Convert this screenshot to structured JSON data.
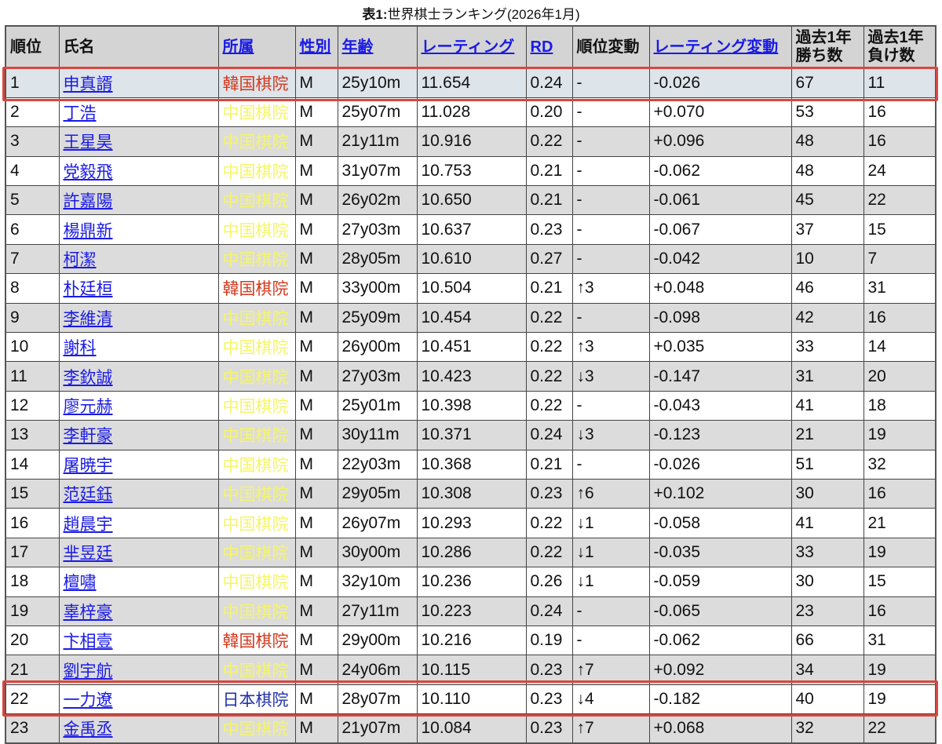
{
  "caption": {
    "prefix": "表1:",
    "text": "世界棋士ランキング(2026年1月)"
  },
  "headers": [
    {
      "label": "順位",
      "link": false
    },
    {
      "label": "氏名",
      "link": false
    },
    {
      "label": "所属",
      "link": true
    },
    {
      "label": "性別",
      "link": true
    },
    {
      "label": "年齢",
      "link": true
    },
    {
      "label": "レーティング",
      "link": true
    },
    {
      "label": "RD",
      "link": true
    },
    {
      "label": "順位変動",
      "link": false
    },
    {
      "label": "レーティング変動",
      "link": true
    },
    {
      "label": "過去1年勝ち数",
      "link": false
    },
    {
      "label": "過去1年負け数",
      "link": false
    }
  ],
  "affiliations": {
    "cn": "中国棋院",
    "kr": "韓国棋院",
    "jp": "日本棋院"
  },
  "colors": {
    "highlight_box": "#d9473f",
    "link": "#1a1ae6",
    "kr": "#d33a1f",
    "cn": "#f5f56a",
    "jp": "#2233aa"
  },
  "rows": [
    {
      "rank": "1",
      "name": "申真諝",
      "aff": "kr",
      "sex": "M",
      "age": "25y10m",
      "rating": "11.654",
      "rd": "0.24",
      "rank_change": "-",
      "rating_change": "-0.026",
      "wins": "67",
      "losses": "11"
    },
    {
      "rank": "2",
      "name": "丁浩",
      "aff": "cn",
      "sex": "M",
      "age": "25y07m",
      "rating": "11.028",
      "rd": "0.20",
      "rank_change": "-",
      "rating_change": "+0.070",
      "wins": "53",
      "losses": "16"
    },
    {
      "rank": "3",
      "name": "王星昊",
      "aff": "cn",
      "sex": "M",
      "age": "21y11m",
      "rating": "10.916",
      "rd": "0.22",
      "rank_change": "-",
      "rating_change": "+0.096",
      "wins": "48",
      "losses": "16"
    },
    {
      "rank": "4",
      "name": "党毅飛",
      "aff": "cn",
      "sex": "M",
      "age": "31y07m",
      "rating": "10.753",
      "rd": "0.21",
      "rank_change": "-",
      "rating_change": "-0.062",
      "wins": "48",
      "losses": "24"
    },
    {
      "rank": "5",
      "name": "許嘉陽",
      "aff": "cn",
      "sex": "M",
      "age": "26y02m",
      "rating": "10.650",
      "rd": "0.21",
      "rank_change": "-",
      "rating_change": "-0.061",
      "wins": "45",
      "losses": "22"
    },
    {
      "rank": "6",
      "name": "楊鼎新",
      "aff": "cn",
      "sex": "M",
      "age": "27y03m",
      "rating": "10.637",
      "rd": "0.23",
      "rank_change": "-",
      "rating_change": "-0.067",
      "wins": "37",
      "losses": "15"
    },
    {
      "rank": "7",
      "name": "柯潔",
      "aff": "cn",
      "sex": "M",
      "age": "28y05m",
      "rating": "10.610",
      "rd": "0.27",
      "rank_change": "-",
      "rating_change": "-0.042",
      "wins": "10",
      "losses": "7"
    },
    {
      "rank": "8",
      "name": "朴廷桓",
      "aff": "kr",
      "sex": "M",
      "age": "33y00m",
      "rating": "10.504",
      "rd": "0.21",
      "rank_change": "↑3",
      "rating_change": "+0.048",
      "wins": "46",
      "losses": "31"
    },
    {
      "rank": "9",
      "name": "李維清",
      "aff": "cn",
      "sex": "M",
      "age": "25y09m",
      "rating": "10.454",
      "rd": "0.22",
      "rank_change": "-",
      "rating_change": "-0.098",
      "wins": "42",
      "losses": "16"
    },
    {
      "rank": "10",
      "name": "謝科",
      "aff": "cn",
      "sex": "M",
      "age": "26y00m",
      "rating": "10.451",
      "rd": "0.22",
      "rank_change": "↑3",
      "rating_change": "+0.035",
      "wins": "33",
      "losses": "14"
    },
    {
      "rank": "11",
      "name": "李欽誠",
      "aff": "cn",
      "sex": "M",
      "age": "27y03m",
      "rating": "10.423",
      "rd": "0.22",
      "rank_change": "↓3",
      "rating_change": "-0.147",
      "wins": "31",
      "losses": "20"
    },
    {
      "rank": "12",
      "name": "廖元赫",
      "aff": "cn",
      "sex": "M",
      "age": "25y01m",
      "rating": "10.398",
      "rd": "0.22",
      "rank_change": "-",
      "rating_change": "-0.043",
      "wins": "41",
      "losses": "18"
    },
    {
      "rank": "13",
      "name": "李軒豪",
      "aff": "cn",
      "sex": "M",
      "age": "30y11m",
      "rating": "10.371",
      "rd": "0.24",
      "rank_change": "↓3",
      "rating_change": "-0.123",
      "wins": "21",
      "losses": "19"
    },
    {
      "rank": "14",
      "name": "屠暁宇",
      "aff": "cn",
      "sex": "M",
      "age": "22y03m",
      "rating": "10.368",
      "rd": "0.21",
      "rank_change": "-",
      "rating_change": "-0.026",
      "wins": "51",
      "losses": "32"
    },
    {
      "rank": "15",
      "name": "范廷鈺",
      "aff": "cn",
      "sex": "M",
      "age": "29y05m",
      "rating": "10.308",
      "rd": "0.23",
      "rank_change": "↑6",
      "rating_change": "+0.102",
      "wins": "30",
      "losses": "16"
    },
    {
      "rank": "16",
      "name": "趙晨宇",
      "aff": "cn",
      "sex": "M",
      "age": "26y07m",
      "rating": "10.293",
      "rd": "0.22",
      "rank_change": "↓1",
      "rating_change": "-0.058",
      "wins": "41",
      "losses": "21"
    },
    {
      "rank": "17",
      "name": "芈昱廷",
      "aff": "cn",
      "sex": "M",
      "age": "30y00m",
      "rating": "10.286",
      "rd": "0.22",
      "rank_change": "↓1",
      "rating_change": "-0.035",
      "wins": "33",
      "losses": "19"
    },
    {
      "rank": "18",
      "name": "檀嘯",
      "aff": "cn",
      "sex": "M",
      "age": "32y10m",
      "rating": "10.236",
      "rd": "0.26",
      "rank_change": "↓1",
      "rating_change": "-0.059",
      "wins": "30",
      "losses": "15"
    },
    {
      "rank": "19",
      "name": "辜梓豪",
      "aff": "cn",
      "sex": "M",
      "age": "27y11m",
      "rating": "10.223",
      "rd": "0.24",
      "rank_change": "-",
      "rating_change": "-0.065",
      "wins": "23",
      "losses": "16"
    },
    {
      "rank": "20",
      "name": "卞相壹",
      "aff": "kr",
      "sex": "M",
      "age": "29y00m",
      "rating": "10.216",
      "rd": "0.19",
      "rank_change": "-",
      "rating_change": "-0.062",
      "wins": "66",
      "losses": "31"
    },
    {
      "rank": "21",
      "name": "劉宇航",
      "aff": "cn",
      "sex": "M",
      "age": "24y06m",
      "rating": "10.115",
      "rd": "0.23",
      "rank_change": "↑7",
      "rating_change": "+0.092",
      "wins": "34",
      "losses": "19"
    },
    {
      "rank": "22",
      "name": "一力遼",
      "aff": "jp",
      "sex": "M",
      "age": "28y07m",
      "rating": "10.110",
      "rd": "0.23",
      "rank_change": "↓4",
      "rating_change": "-0.182",
      "wins": "40",
      "losses": "19"
    },
    {
      "rank": "23",
      "name": "金禹丞",
      "aff": "cn",
      "sex": "M",
      "age": "21y07m",
      "rating": "10.084",
      "rd": "0.23",
      "rank_change": "↑7",
      "rating_change": "+0.068",
      "wins": "32",
      "losses": "22"
    }
  ],
  "highlighted_ranks": [
    "1",
    "22"
  ]
}
